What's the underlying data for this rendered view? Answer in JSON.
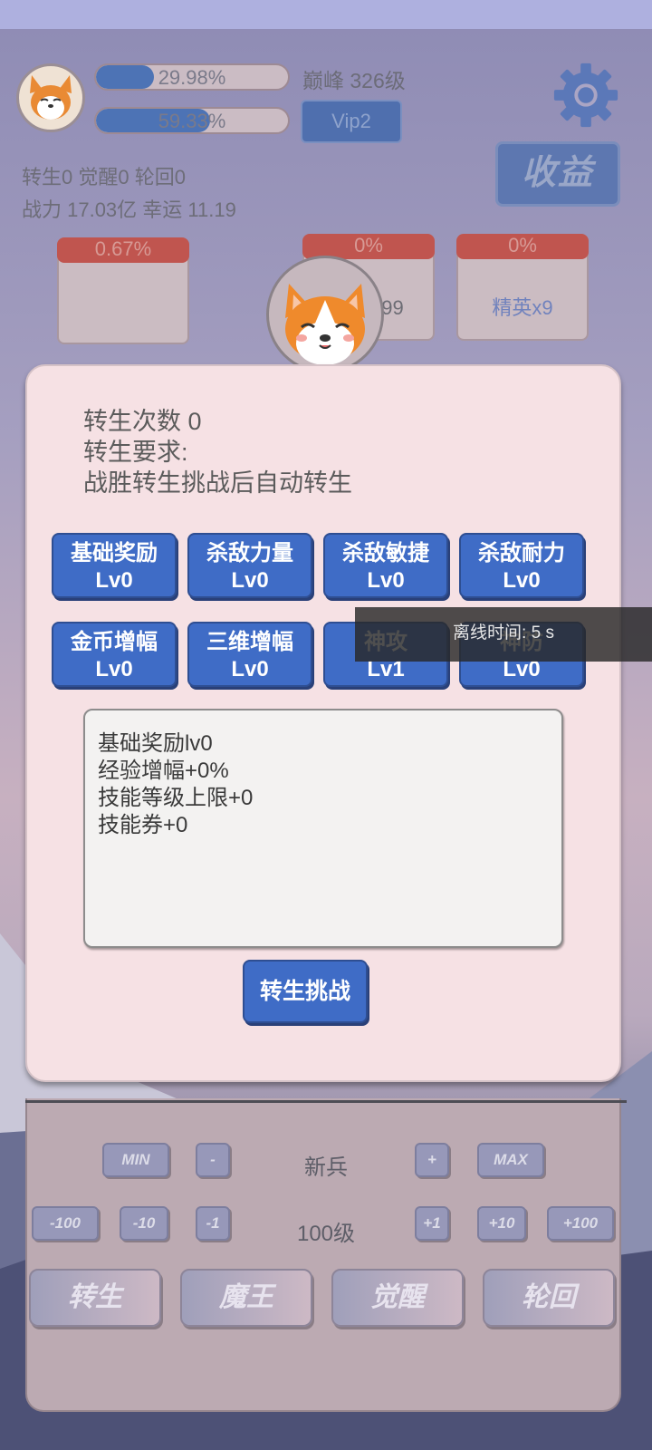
{
  "header": {
    "exp_bar_text": "29.98%",
    "exp_progress": 0.2998,
    "second_bar_text": "59.33%",
    "second_progress": 0.5933,
    "level_text": "巅峰 326级",
    "vip_label": "Vip2",
    "income_label": "收益",
    "stats_line1": "转生0 觉醒0 轮回0",
    "stats_line2": "战力 17.03亿  幸运 11.19"
  },
  "enemy_cards": [
    {
      "hp_text": "0.67%",
      "label": ""
    },
    {
      "hp_text": "0%",
      "label": "怪x99"
    },
    {
      "hp_text": "0%",
      "label": "精英x9"
    }
  ],
  "modal": {
    "line1": "转生次数 0",
    "line2": "转生要求:",
    "line3": "战胜转生挑战后自动转生",
    "skills": [
      {
        "name": "基础奖励",
        "level": "Lv0"
      },
      {
        "name": "杀敌力量",
        "level": "Lv0"
      },
      {
        "name": "杀敌敏捷",
        "level": "Lv0"
      },
      {
        "name": "杀敌耐力",
        "level": "Lv0"
      },
      {
        "name": "金币增幅",
        "level": "Lv0"
      },
      {
        "name": "三维增幅",
        "level": "Lv0"
      },
      {
        "name": "神攻",
        "level": "Lv1"
      },
      {
        "name": "神防",
        "level": "Lv0"
      }
    ],
    "description": [
      "基础奖励lv0",
      "经验增幅+0%",
      "技能等级上限+0",
      "技能券+0"
    ],
    "challenge_label": "转生挑战"
  },
  "toast": {
    "text": "离线时间: 5 s"
  },
  "bottom": {
    "row1": {
      "min": "MIN",
      "minus": "-",
      "center": "新兵",
      "plus": "+",
      "max": "MAX"
    },
    "row2": {
      "m100": "-100",
      "m10": "-10",
      "m1": "-1",
      "center": "100级",
      "p1": "+1",
      "p10": "+10",
      "p100": "+100"
    },
    "tabs": [
      "转生",
      "魔王",
      "觉醒",
      "轮回"
    ]
  },
  "colors": {
    "accent_blue": "#3f6cc6",
    "hp_red": "#c0554f",
    "modal_bg": "#f6e1e4"
  }
}
